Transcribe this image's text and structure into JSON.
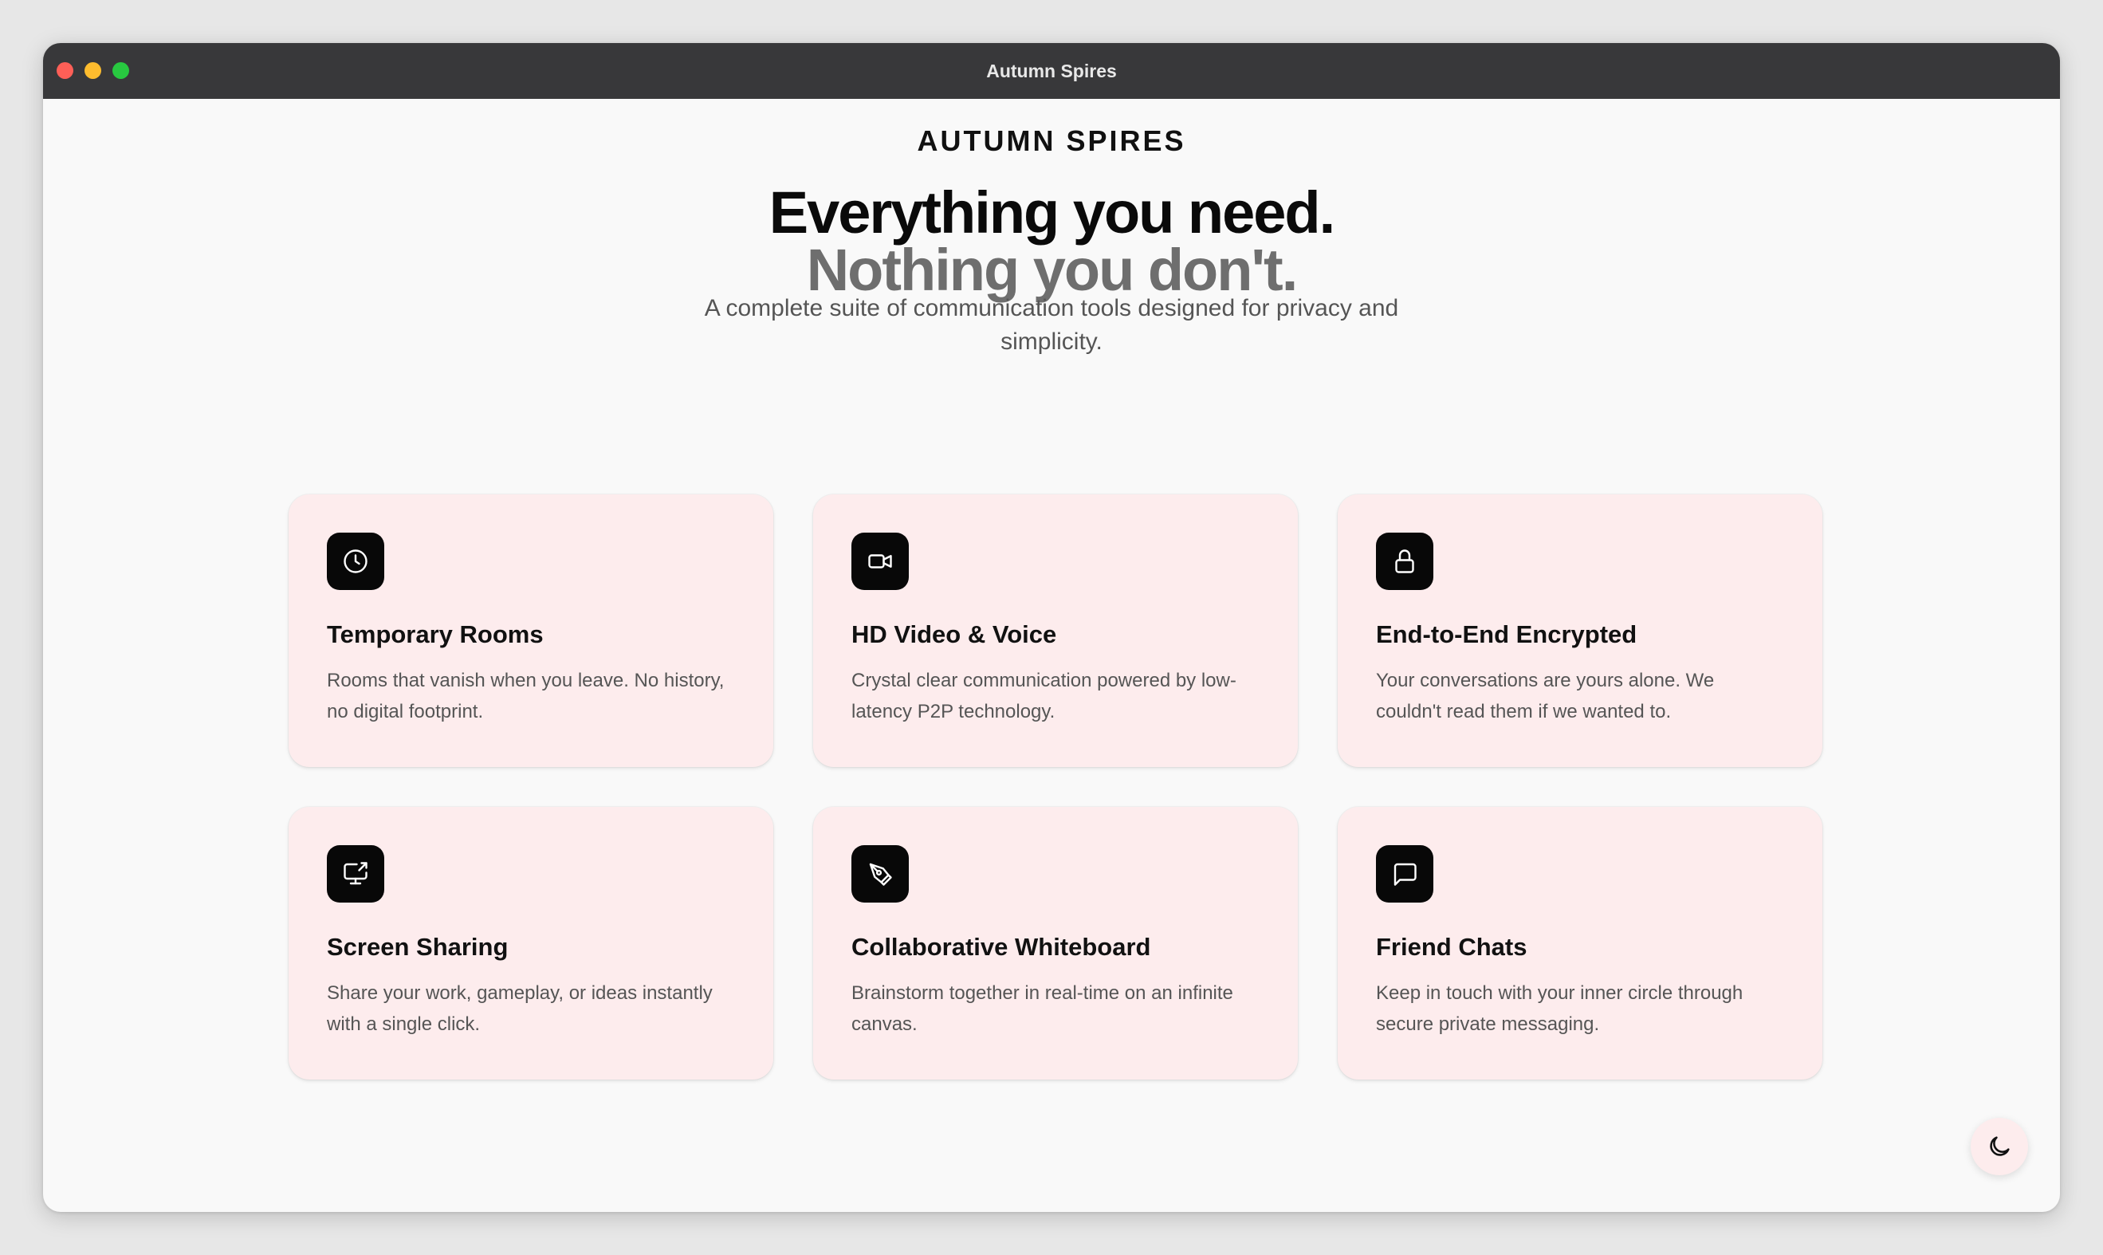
{
  "window": {
    "title": "Autumn Spires"
  },
  "brand": {
    "name": "AUTUMN SPIRES"
  },
  "hero": {
    "line1": "Everything you need.",
    "line2": "Nothing you don't.",
    "subtitle": "A complete suite of communication tools designed for privacy and simplicity."
  },
  "features": [
    {
      "icon": "clock-icon",
      "title": "Temporary Rooms",
      "description": "Rooms that vanish when you leave. No history, no digital footprint."
    },
    {
      "icon": "video-icon",
      "title": "HD Video & Voice",
      "description": "Crystal clear communication powered by low-latency P2P technology."
    },
    {
      "icon": "lock-icon",
      "title": "End-to-End Encrypted",
      "description": "Your conversations are yours alone. We couldn't read them if we wanted to."
    },
    {
      "icon": "screen-share-icon",
      "title": "Screen Sharing",
      "description": "Share your work, gameplay, or ideas instantly with a single click."
    },
    {
      "icon": "pen-tool-icon",
      "title": "Collaborative Whiteboard",
      "description": "Brainstorm together in real-time on an infinite canvas."
    },
    {
      "icon": "message-square-icon",
      "title": "Friend Chats",
      "description": "Keep in touch with your inner circle through secure private messaging."
    }
  ],
  "theme_toggle": {
    "icon": "moon-icon"
  },
  "colors": {
    "titlebar": "#38383a",
    "card_background": "#fdeced",
    "icon_tile": "#080808",
    "heading": "#0a0a0a",
    "heading_muted": "#6e6e6e"
  }
}
